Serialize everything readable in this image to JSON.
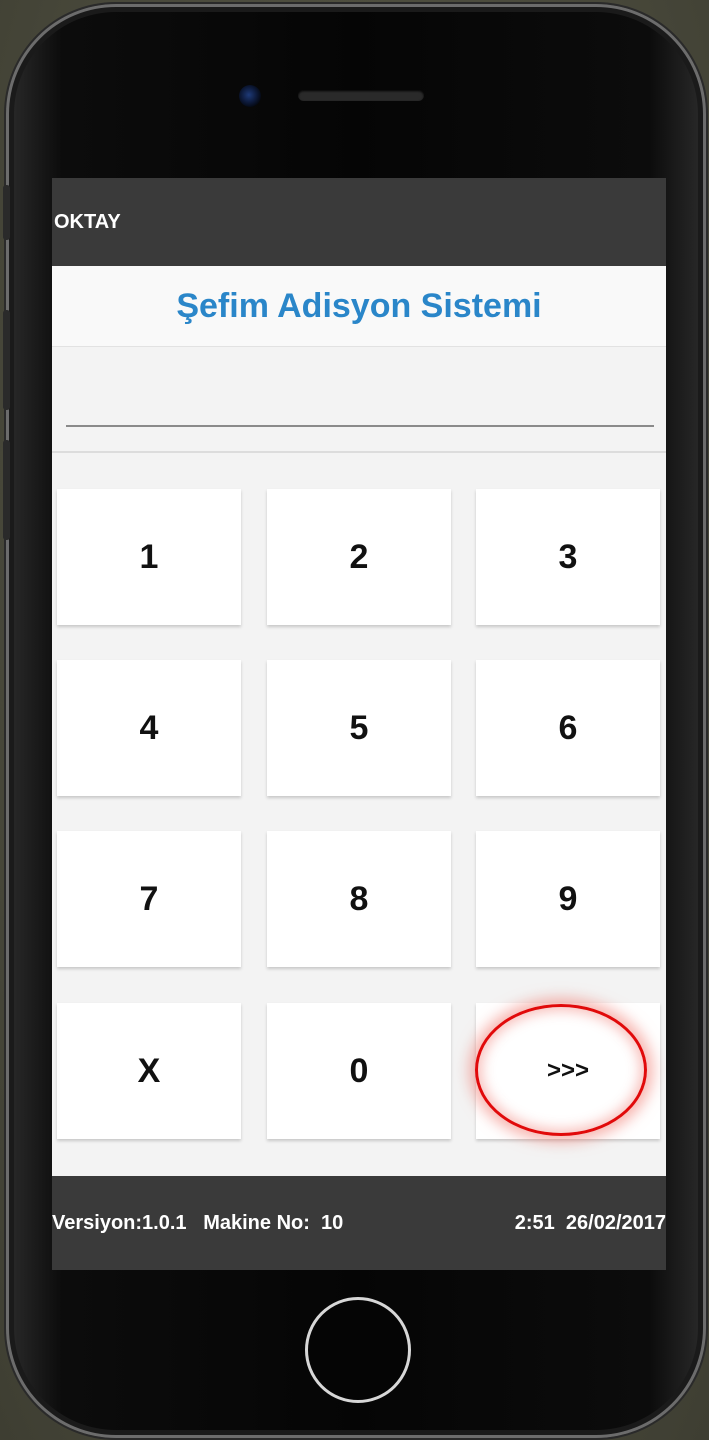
{
  "appbar": {
    "title": "OKTAY"
  },
  "header": {
    "title": "Şefim Adisyon Sistemi"
  },
  "input": {
    "value": "",
    "placeholder": ""
  },
  "keypad": {
    "keys": [
      "1",
      "2",
      "3",
      "4",
      "5",
      "6",
      "7",
      "8",
      "9",
      "X",
      "0",
      ">>>"
    ]
  },
  "footer": {
    "version": "Versiyon:1.0.1",
    "machine": "Makine No:  10",
    "time": "2:51",
    "date": "26/02/2017"
  },
  "colors": {
    "title": "#2a86c9",
    "bars": "#3a3a3a",
    "highlight": "#e10a0a"
  }
}
